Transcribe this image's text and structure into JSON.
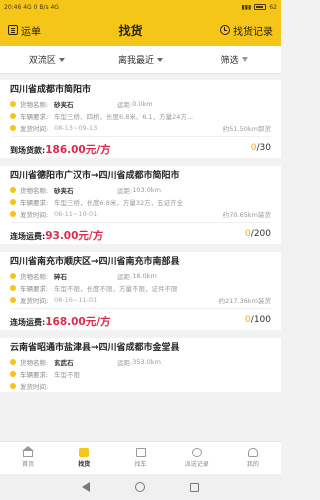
{
  "status": {
    "time": "20:46",
    "network": "4G 0 B/s 4G",
    "battery": "62"
  },
  "header": {
    "left_label": "运单",
    "title": "找货",
    "right_label": "找货记录"
  },
  "filters": [
    {
      "label": "双流区"
    },
    {
      "label": "离我最近"
    },
    {
      "label": "筛选"
    }
  ],
  "cards": [
    {
      "route": "四川省成都市简阳市",
      "goods_label": "货物名称:",
      "goods_value": "砂夹石",
      "goods_right_label": "运距:",
      "goods_right_value": "0.0km",
      "vehicle_label": "车辆要求:",
      "vehicle_value": "车型三桥、四桥，长度6.8米、6.1，方量24方...",
      "date_label": "发货时间:",
      "date_value": "08-13~09-13",
      "distance_note": "约51.50km卸货",
      "price_label": "到场货款:",
      "price_value": "186.00元/方",
      "count_current": "0",
      "count_total": "/30"
    },
    {
      "route": "四川省德阳市广汉市→四川省成都市简阳市",
      "goods_label": "货物名称:",
      "goods_value": "砂夹石",
      "goods_right_label": "运距:",
      "goods_right_value": "103.0km",
      "vehicle_label": "车辆要求:",
      "vehicle_value": "车型三桥，长度6.8米，方量32方，五证齐全",
      "date_label": "发货时间:",
      "date_value": "08-11~10-01",
      "distance_note": "约70.65km装货",
      "price_label": "连场运费:",
      "price_value": "93.00元/方",
      "count_current": "0",
      "count_total": "/200"
    },
    {
      "route": "四川省南充市顺庆区→四川省南充市南部县",
      "goods_label": "货物名称:",
      "goods_value": "碎石",
      "goods_right_label": "运距:",
      "goods_right_value": "18.0km",
      "vehicle_label": "车辆要求:",
      "vehicle_value": "车型不限，长度不限，方量不限，证件不限",
      "date_label": "发货时间:",
      "date_value": "08-16~11-01",
      "distance_note": "约217.36km装货",
      "price_label": "连场运费:",
      "price_value": "168.00元/方",
      "count_current": "0",
      "count_total": "/100"
    },
    {
      "route": "云南省昭通市盐津县→四川省成都市金堂县",
      "goods_label": "货物名称:",
      "goods_value": "玄武石",
      "goods_right_label": "运距:",
      "goods_right_value": "353.0km",
      "vehicle_label": "车辆要求:",
      "vehicle_value": "车型不限",
      "date_label": "发货时间:",
      "date_value": "",
      "distance_note": "",
      "price_label": "",
      "price_value": "",
      "count_current": "",
      "count_total": ""
    }
  ],
  "tabbar": [
    {
      "label": "首页",
      "icon": "home-icon"
    },
    {
      "label": "找货",
      "icon": "goods-icon",
      "active": true
    },
    {
      "label": "找车",
      "icon": "truck-icon"
    },
    {
      "label": "派送记录",
      "icon": "record-icon"
    },
    {
      "label": "我的",
      "icon": "user-icon"
    }
  ],
  "colors": {
    "accent": "#f5c518",
    "price": "#e0284a",
    "counter": "#f5a818"
  }
}
